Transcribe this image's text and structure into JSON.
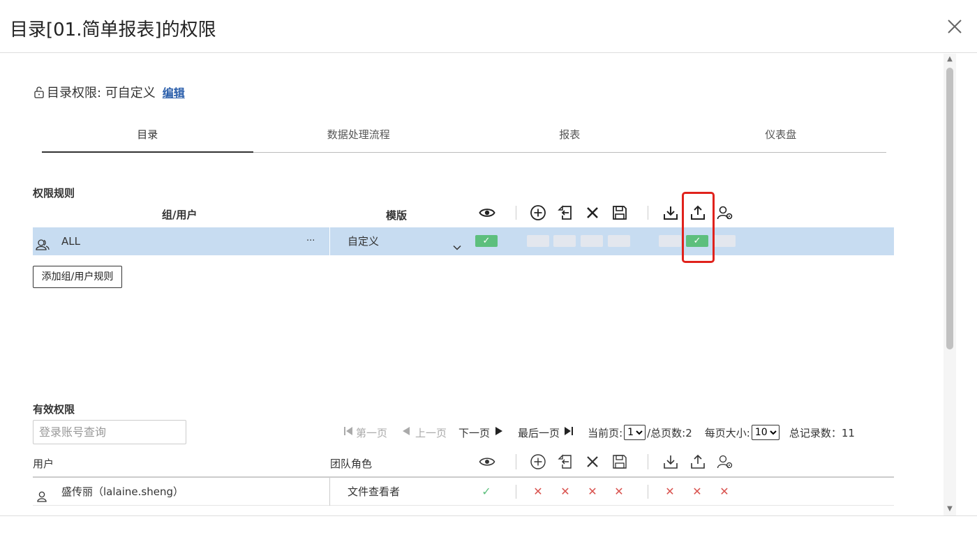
{
  "dialog": {
    "title": "目录[01.简单报表]的权限"
  },
  "permission": {
    "label": "目录权限: 可自定义",
    "edit_link": "编辑"
  },
  "tabs": [
    {
      "label": "目录",
      "active": true
    },
    {
      "label": "数据处理流程",
      "active": false
    },
    {
      "label": "报表",
      "active": false
    },
    {
      "label": "仪表盘",
      "active": false
    }
  ],
  "rules": {
    "section_title": "权限规则",
    "col_group_user": "组/用户",
    "col_template": "模版",
    "row": {
      "name": "ALL",
      "more": "···",
      "template": "自定义",
      "view": true,
      "create": false,
      "move": false,
      "delete": false,
      "save": false,
      "download": false,
      "upload": true,
      "manage": false
    },
    "add_button": "添加组/用户规则"
  },
  "effective": {
    "section_title": "有效权限",
    "search_placeholder": "登录账号查询",
    "pager": {
      "first": "第一页",
      "prev": "上一页",
      "next": "下一页",
      "last": "最后一页",
      "current_label": "当前页:",
      "current_value": "1",
      "total_pages": "/总页数:2",
      "page_size_label": "每页大小:",
      "page_size_value": "10",
      "total_records": "总记录数：11"
    },
    "col_user": "用户",
    "col_role": "团队角色",
    "rows": [
      {
        "user": "盛传丽（lalaine.sheng）",
        "role": "文件查看者",
        "view": "✓",
        "create": "✕",
        "move": "✕",
        "delete": "✕",
        "save": "✕",
        "download": "✕",
        "upload": "✕",
        "manage": "✕"
      }
    ]
  },
  "colors": {
    "selected_row": "#c7dcf1",
    "check_on": "#5dbf7d",
    "check_off": "#e3e7ee",
    "deny": "#d9534f",
    "highlight_box": "#e0221c",
    "link": "#2b5fab"
  },
  "icons": [
    "close-icon",
    "unlock-icon",
    "eye-icon",
    "plus-circle-icon",
    "move-in-icon",
    "delete-x-icon",
    "save-icon",
    "download-icon",
    "upload-icon",
    "user-manage-icon",
    "group-icon",
    "user-icon"
  ]
}
